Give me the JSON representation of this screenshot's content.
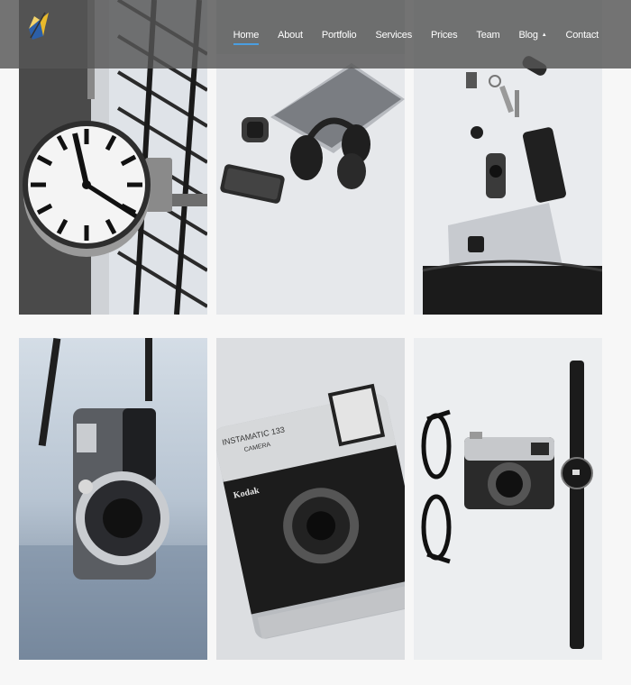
{
  "nav": {
    "items": [
      {
        "label": "Home",
        "active": true
      },
      {
        "label": "About"
      },
      {
        "label": "Portfolio"
      },
      {
        "label": "Services"
      },
      {
        "label": "Prices"
      },
      {
        "label": "Team"
      },
      {
        "label": "Blog",
        "has_dropdown": true
      },
      {
        "label": "Contact"
      }
    ],
    "accent_color": "#4a9ee0"
  },
  "gallery": {
    "items": [
      {
        "subject": "station-clock-photo"
      },
      {
        "subject": "desk-headphones-photo"
      },
      {
        "subject": "bag-laptop-keys-photo"
      },
      {
        "subject": "instax-camera-photo"
      },
      {
        "subject": "kodak-instamatic-photo",
        "printed_text": [
          "INSTAMATIC 133",
          "CAMERA",
          "Kodak"
        ]
      },
      {
        "subject": "glasses-camera-watch-photo"
      }
    ]
  }
}
